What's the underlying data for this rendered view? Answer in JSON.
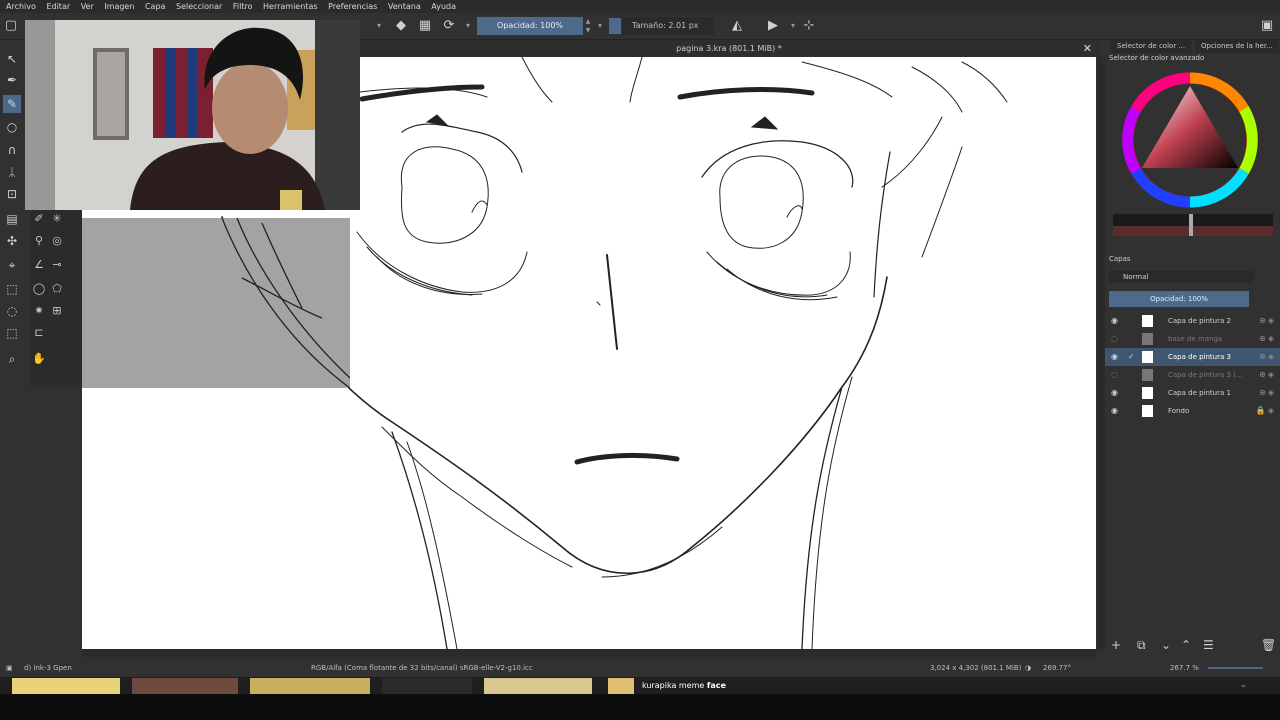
{
  "menu": [
    "Archivo",
    "Editar",
    "Ver",
    "Imagen",
    "Capa",
    "Seleccionar",
    "Filtro",
    "Herramientas",
    "Preferencias",
    "Ventana",
    "Ayuda"
  ],
  "toolbar": {
    "opacity": "Opacidad: 100%",
    "size": "Tamaño: 2.01 px"
  },
  "document": {
    "title": "pagina 3.kra (801.1 MiB) *",
    "close_label": "✕"
  },
  "right_panel": {
    "tabs": [
      "Selector de color ...",
      "Opciones de la her..."
    ],
    "color_selector_title": "Selector de color avanzado",
    "layers_title": "Capas",
    "blend_mode": "Normal",
    "layer_opacity": "Opacidad: 100%",
    "layers": [
      {
        "name": "Capa de pintura 2",
        "visible": true,
        "active": false,
        "dim": false
      },
      {
        "name": "base de manga",
        "visible": false,
        "active": false,
        "dim": true
      },
      {
        "name": "Capa de pintura 3",
        "visible": true,
        "active": true,
        "dim": false
      },
      {
        "name": "Capa de pintura 3 (...",
        "visible": false,
        "active": false,
        "dim": true
      },
      {
        "name": "Capa de pintura 1",
        "visible": true,
        "active": false,
        "dim": false
      },
      {
        "name": "Fondo",
        "visible": true,
        "active": false,
        "dim": false
      }
    ]
  },
  "status": {
    "brush": "d) Ink-3 Gpen",
    "colorspace": "RGB/Alfa (Coma flotante de 32 bits/canal)  sRGB-elle-V2-g10.icc",
    "dimensions": "3,024 x 4,302 (801.1 MiB)",
    "rotation": "269.77°",
    "zoom": "267.7 %"
  },
  "taskbar": {
    "search_label_prefix": "kurapika meme ",
    "search_label_bold": "face"
  },
  "colors": {
    "accent": "#4d6a8a",
    "panel": "#313131",
    "canvas": "#ffffff"
  }
}
